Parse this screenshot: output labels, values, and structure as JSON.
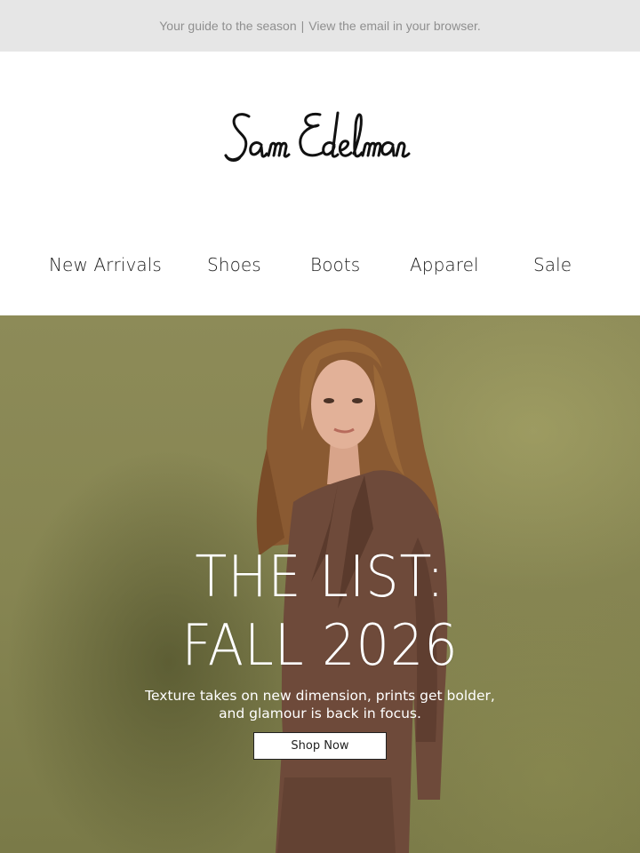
{
  "preheader": {
    "guide_text": "Your guide to the season",
    "separator": "|",
    "browser_link": "View the email in your browser."
  },
  "brand": {
    "logo_text": "Sam Edelman"
  },
  "nav": {
    "items": [
      {
        "label": "New Arrivals"
      },
      {
        "label": "Shoes"
      },
      {
        "label": "Boots"
      },
      {
        "label": "Apparel"
      },
      {
        "label": "Sale"
      }
    ]
  },
  "hero": {
    "headline_line1": "THE LIST:",
    "headline_line2": "FALL 2026",
    "subcopy_line1": "Texture takes on new dimension, prints get bolder,",
    "subcopy_line2": "and glamour is back in focus.",
    "cta_label": "Shop Now",
    "background_color": "#878552",
    "image_subject": "model-photo"
  }
}
